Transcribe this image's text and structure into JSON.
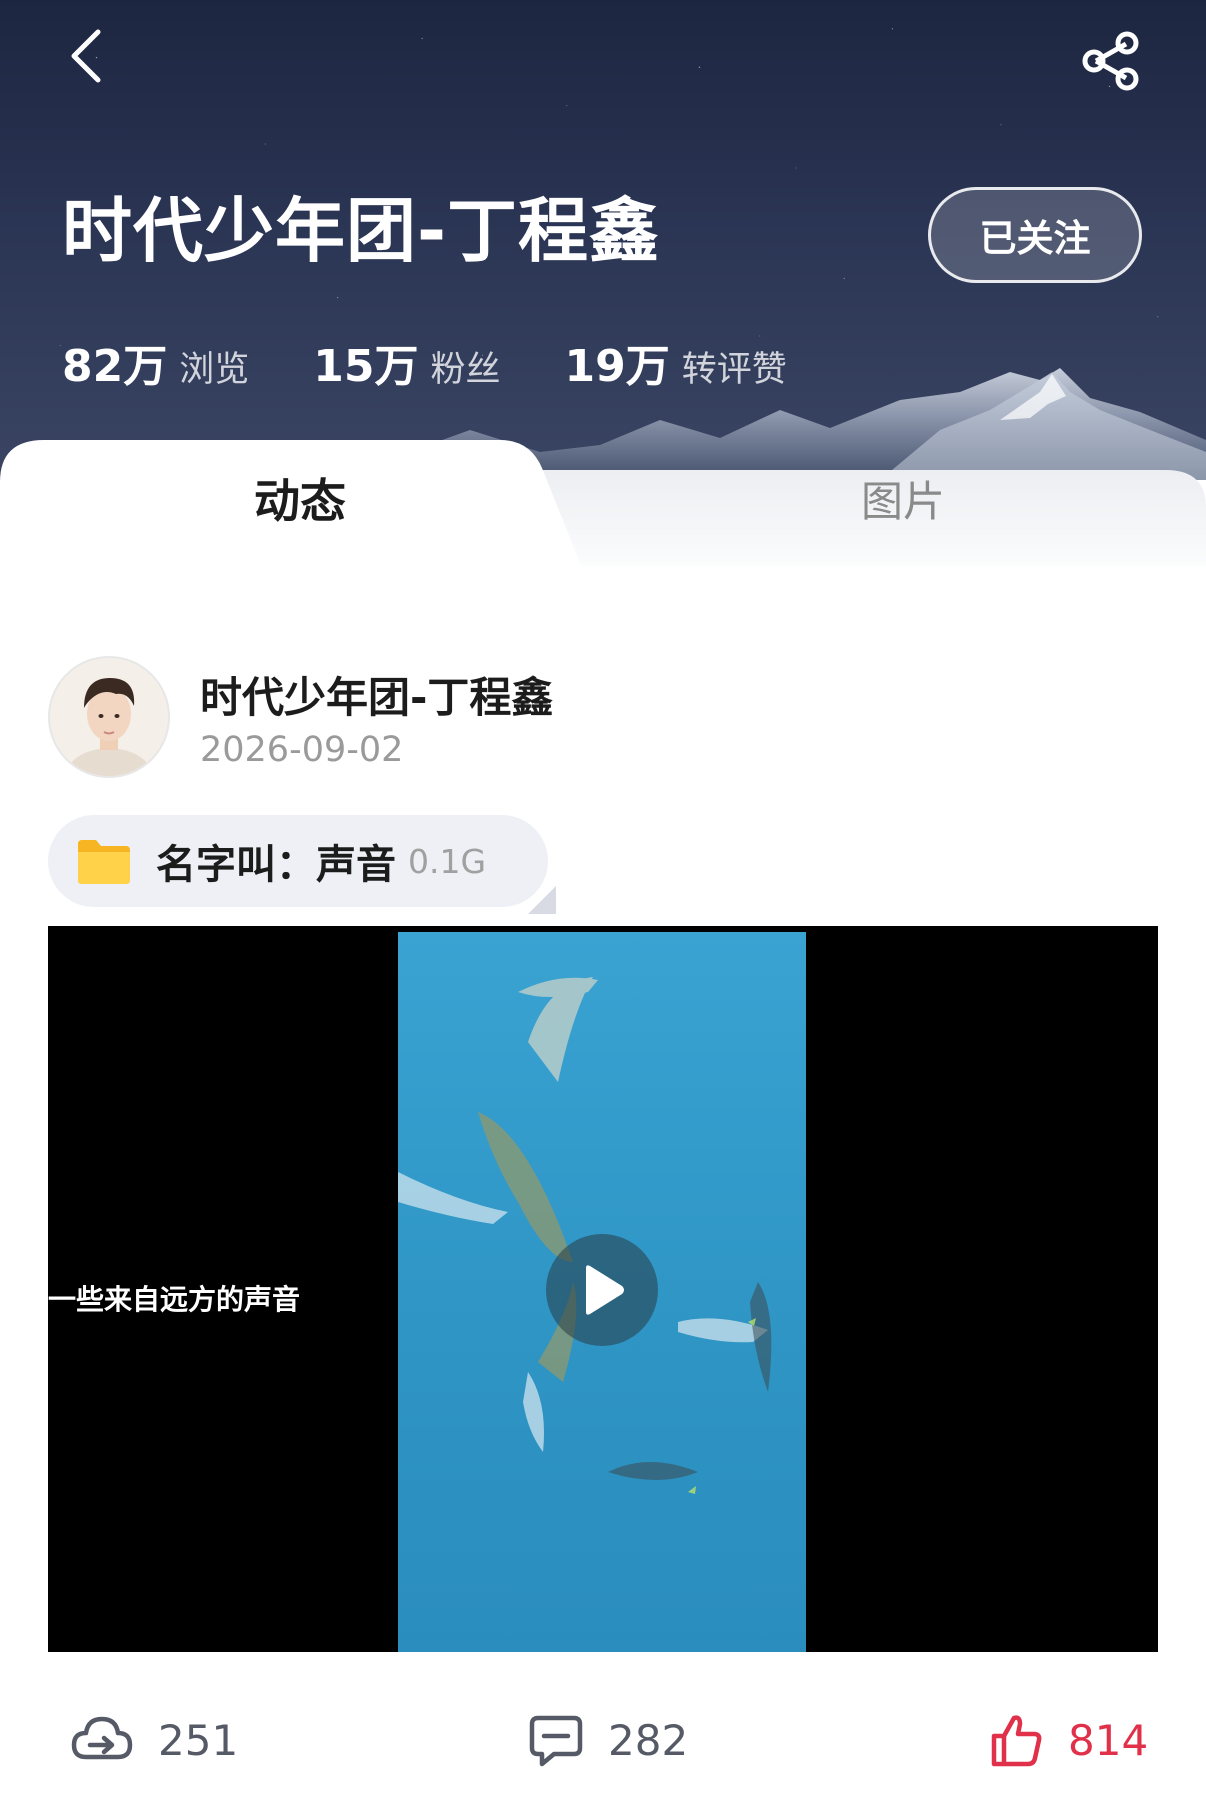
{
  "header": {
    "title": "时代少年团-丁程鑫",
    "follow_label": "已关注",
    "stats": [
      {
        "value": "82万",
        "label": "浏览"
      },
      {
        "value": "15万",
        "label": "粉丝"
      },
      {
        "value": "19万",
        "label": "转评赞"
      }
    ]
  },
  "tabs": [
    {
      "label": "动态",
      "active": true
    },
    {
      "label": "图片",
      "active": false
    }
  ],
  "post": {
    "author": "时代少年团-丁程鑫",
    "date": "2026-09-02",
    "file": {
      "name": "名字叫：声音",
      "size": "0.1G"
    },
    "video": {
      "caption": "一些来自远方的声音"
    },
    "actions": {
      "share_count": "251",
      "comment_count": "282",
      "like_count": "814"
    }
  },
  "icons": {
    "back": "chevron-left-icon",
    "share": "share-nodes-icon",
    "folder": "folder-icon",
    "play": "play-icon",
    "cloud_share": "cloud-share-icon",
    "comment": "comment-icon",
    "like": "thumbs-up-icon"
  },
  "colors": {
    "header_bg": "#2a3453",
    "like_active": "#e0304a",
    "folder": "#ffc93a",
    "muted_text": "#9a9a9a"
  }
}
